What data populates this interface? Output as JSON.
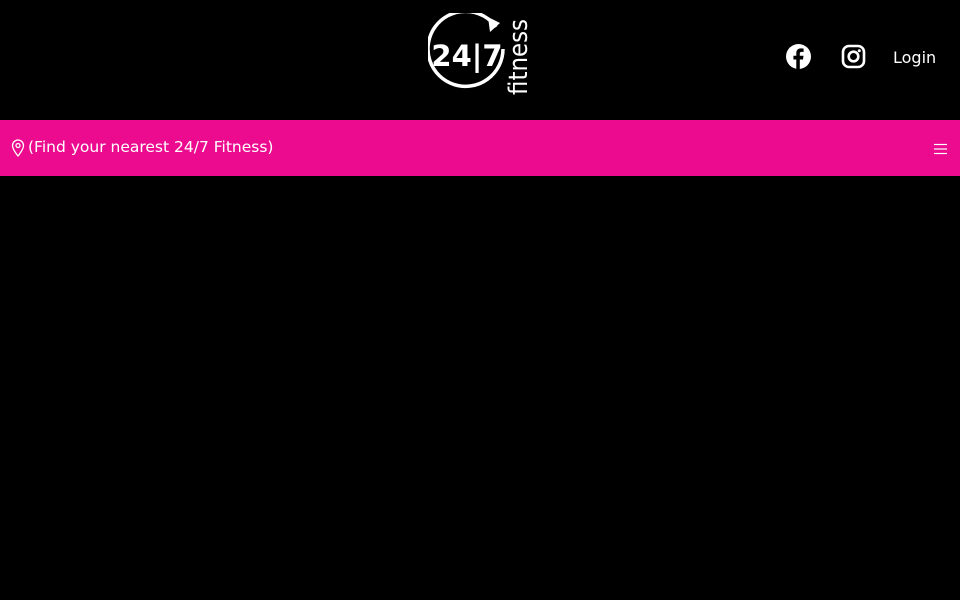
{
  "header": {
    "logo_icon": "24-7-fitness-logo",
    "logo_text_main": "24|7",
    "logo_text_side": "fitness",
    "facebook_icon": "facebook-icon",
    "instagram_icon": "instagram-icon",
    "login_label": "Login"
  },
  "location_bar": {
    "pin_icon": "location-pin-icon",
    "find_label": "(Find your nearest 24/7 Fitness)",
    "menu_icon": "hamburger-menu-icon"
  },
  "colors": {
    "background": "#000000",
    "accent": "#ec0a8f",
    "text": "#ffffff"
  }
}
